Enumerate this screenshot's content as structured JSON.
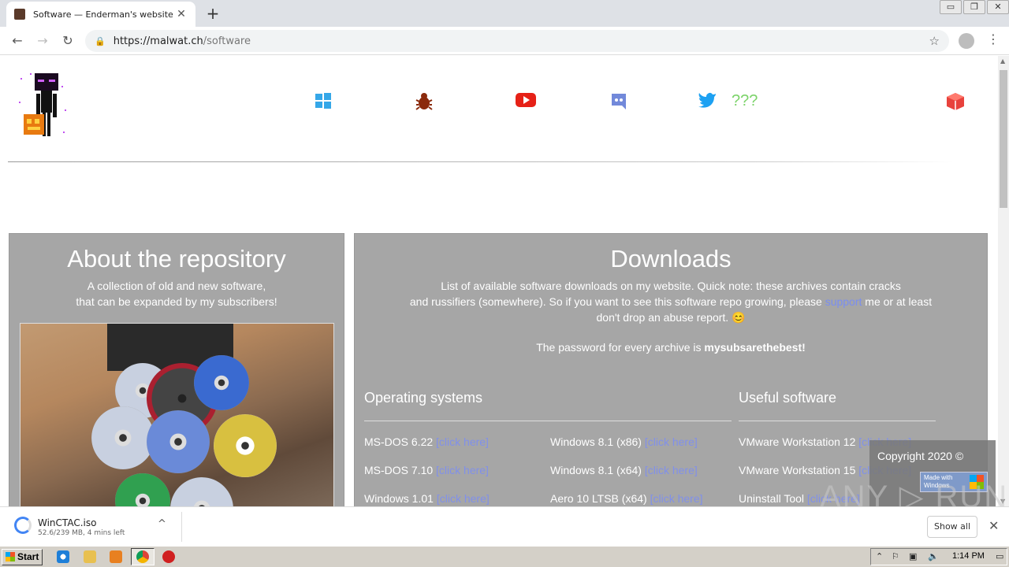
{
  "browser": {
    "tab_title": "Software — Enderman's website",
    "tab_close": "✕",
    "new_tab": "+",
    "url_host": "https://malwat.ch",
    "url_path": "/software",
    "back": "←",
    "forward": "→",
    "reload": "↻",
    "star": "☆",
    "menu": "⋮",
    "win_minimize": "▭",
    "win_restore": "❐",
    "win_close": "✕"
  },
  "nav": {
    "question_marks": "???"
  },
  "about": {
    "title": "About the repository",
    "line1": "A collection of old and new software,",
    "line2": "that can be expanded by my subscribers!"
  },
  "downloads": {
    "title": "Downloads",
    "intro_1": "List of available software downloads on my website. Quick note: these archives contain cracks",
    "intro_2a": "and russifiers (somewhere). So if you want to see this software repo growing, please ",
    "intro_support": "support",
    "intro_2b": " me or at least",
    "intro_3": "don't drop an abuse report. 😊",
    "password_prefix": "The password for every archive is ",
    "password": "mysubsarethebest!",
    "os_title": "Operating systems",
    "useful_title": "Useful software",
    "link_text": "[click here]",
    "os_col1": [
      "MS-DOS 6.22",
      "MS-DOS 7.10",
      "Windows 1.01"
    ],
    "os_col2": [
      "Windows 8.1 (x86)",
      "Windows 8.1 (x64)",
      "Aero 10 LTSB (x64)"
    ],
    "useful": [
      "VMware Workstation 12",
      "VMware Workstation 15",
      "Uninstall Tool"
    ]
  },
  "footer_box": {
    "copyright": "Copyright 2020 ©",
    "badge_line1": "Made with",
    "badge_line2": "Windows"
  },
  "watermark": "ANY ▷ RUN",
  "download_bar": {
    "file_name": "WinCTAC.iso",
    "progress": "52.6/239 MB, 4 mins left",
    "chevron": "^",
    "show_all": "Show all",
    "close": "✕"
  },
  "taskbar": {
    "start": "Start",
    "time": "1:14 PM"
  },
  "colors": {
    "panel_bg": "#a6a6a6",
    "link": "#7a8ef0",
    "windows_icon": "#35a7e8",
    "bug_icon": "#8b2a0c",
    "youtube_icon": "#e62117",
    "discord_icon": "#7289da",
    "twitter_icon": "#1da1f2",
    "qq_text": "#7cd36a",
    "box_icon": "#e8423c"
  }
}
